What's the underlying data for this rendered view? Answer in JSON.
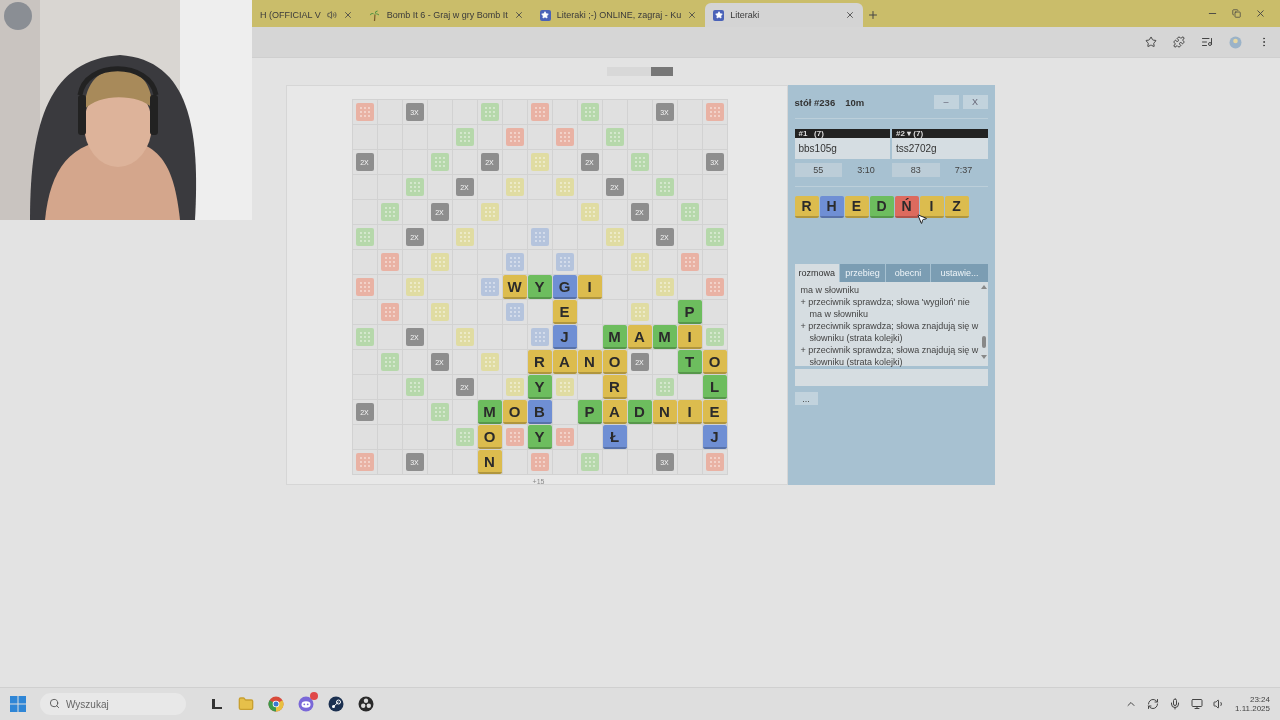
{
  "browser": {
    "tabs": [
      {
        "title": "H (OFFICIAL V",
        "kind": "music",
        "selected": false
      },
      {
        "title": "Bomb It 6 - Graj w gry Bomb It",
        "kind": "palm",
        "selected": false
      },
      {
        "title": "Literaki ;-) ONLINE, zagraj - Ku",
        "kind": "star",
        "selected": false
      },
      {
        "title": "Literaki",
        "kind": "star",
        "selected": true
      }
    ]
  },
  "board": {
    "rows": [
      [
        {
          "kind": "bonus",
          "color": "#e9b2a4"
        },
        {
          "kind": "plain"
        },
        {
          "kind": "multiplier",
          "label": "3X"
        },
        {
          "kind": "plain"
        },
        {
          "kind": "plain"
        },
        {
          "kind": "bonus",
          "color": "#b6d8ab"
        },
        {
          "kind": "plain"
        },
        {
          "kind": "bonus",
          "color": "#e9b2a4"
        },
        {
          "kind": "plain"
        },
        {
          "kind": "bonus",
          "color": "#b6d8ab"
        },
        {
          "kind": "plain"
        },
        {
          "kind": "plain"
        },
        {
          "kind": "multiplier",
          "label": "3X"
        },
        {
          "kind": "plain"
        },
        {
          "kind": "bonus",
          "color": "#e9b2a4"
        }
      ],
      [
        {
          "kind": "plain"
        },
        {
          "kind": "plain"
        },
        {
          "kind": "plain"
        },
        {
          "kind": "plain"
        },
        {
          "kind": "bonus",
          "color": "#b6d8ab"
        },
        {
          "kind": "plain"
        },
        {
          "kind": "bonus",
          "color": "#e9b2a4"
        },
        {
          "kind": "plain"
        },
        {
          "kind": "bonus",
          "color": "#e9b2a4"
        },
        {
          "kind": "plain"
        },
        {
          "kind": "bonus",
          "color": "#b6d8ab"
        },
        {
          "kind": "plain"
        },
        {
          "kind": "plain"
        },
        {
          "kind": "plain"
        },
        {
          "kind": "plain"
        }
      ],
      [
        {
          "kind": "multiplier",
          "label": "2X"
        },
        {
          "kind": "plain"
        },
        {
          "kind": "plain"
        },
        {
          "kind": "bonus",
          "color": "#b6d8ab"
        },
        {
          "kind": "plain"
        },
        {
          "kind": "multiplier",
          "label": "2X"
        },
        {
          "kind": "plain"
        },
        {
          "kind": "bonus",
          "color": "#e0dca2"
        },
        {
          "kind": "plain"
        },
        {
          "kind": "multiplier",
          "label": "2X"
        },
        {
          "kind": "plain"
        },
        {
          "kind": "bonus",
          "color": "#b6d8ab"
        },
        {
          "kind": "plain"
        },
        {
          "kind": "plain"
        },
        {
          "kind": "multiplier",
          "label": "3X"
        }
      ],
      [
        {
          "kind": "plain"
        },
        {
          "kind": "plain"
        },
        {
          "kind": "bonus",
          "color": "#b6d8ab"
        },
        {
          "kind": "plain"
        },
        {
          "kind": "multiplier",
          "label": "2X"
        },
        {
          "kind": "plain"
        },
        {
          "kind": "bonus",
          "color": "#e0dca2"
        },
        {
          "kind": "plain"
        },
        {
          "kind": "bonus",
          "color": "#e0dca2"
        },
        {
          "kind": "plain"
        },
        {
          "kind": "multiplier",
          "label": "2X"
        },
        {
          "kind": "plain"
        },
        {
          "kind": "bonus",
          "color": "#b6d8ab"
        },
        {
          "kind": "plain"
        },
        {
          "kind": "plain"
        }
      ],
      [
        {
          "kind": "plain"
        },
        {
          "kind": "bonus",
          "color": "#b6d8ab"
        },
        {
          "kind": "plain"
        },
        {
          "kind": "multiplier",
          "label": "2X"
        },
        {
          "kind": "plain"
        },
        {
          "kind": "bonus",
          "color": "#e0dca2"
        },
        {
          "kind": "plain"
        },
        {
          "kind": "plain"
        },
        {
          "kind": "plain"
        },
        {
          "kind": "bonus",
          "color": "#e0dca2"
        },
        {
          "kind": "plain"
        },
        {
          "kind": "multiplier",
          "label": "2X"
        },
        {
          "kind": "plain"
        },
        {
          "kind": "bonus",
          "color": "#b6d8ab"
        },
        {
          "kind": "plain"
        }
      ],
      [
        {
          "kind": "bonus",
          "color": "#b6d8ab"
        },
        {
          "kind": "plain"
        },
        {
          "kind": "multiplier",
          "label": "2X"
        },
        {
          "kind": "plain"
        },
        {
          "kind": "bonus",
          "color": "#e0dca2"
        },
        {
          "kind": "plain"
        },
        {
          "kind": "plain"
        },
        {
          "kind": "bonus",
          "color": "#b5c4dd"
        },
        {
          "kind": "plain"
        },
        {
          "kind": "plain"
        },
        {
          "kind": "bonus",
          "color": "#e0dca2"
        },
        {
          "kind": "plain"
        },
        {
          "kind": "multiplier",
          "label": "2X"
        },
        {
          "kind": "plain"
        },
        {
          "kind": "bonus",
          "color": "#b6d8ab"
        }
      ],
      [
        {
          "kind": "plain"
        },
        {
          "kind": "bonus",
          "color": "#e9b2a4"
        },
        {
          "kind": "plain"
        },
        {
          "kind": "bonus",
          "color": "#e0dca2"
        },
        {
          "kind": "plain"
        },
        {
          "kind": "plain"
        },
        {
          "kind": "bonus",
          "color": "#b5c4dd"
        },
        {
          "kind": "plain"
        },
        {
          "kind": "bonus",
          "color": "#b5c4dd"
        },
        {
          "kind": "plain"
        },
        {
          "kind": "plain"
        },
        {
          "kind": "bonus",
          "color": "#e0dca2"
        },
        {
          "kind": "plain"
        },
        {
          "kind": "bonus",
          "color": "#e9b2a4"
        },
        {
          "kind": "plain"
        }
      ],
      [
        {
          "kind": "bonus",
          "color": "#e9b2a4"
        },
        {
          "kind": "plain"
        },
        {
          "kind": "bonus",
          "color": "#e0dca2"
        },
        {
          "kind": "plain"
        },
        {
          "kind": "plain"
        },
        {
          "kind": "bonus",
          "color": "#b5c4dd"
        },
        {
          "kind": "tile",
          "letter": "W",
          "color": "#dcbc4e"
        },
        {
          "kind": "tile",
          "letter": "Y",
          "color": "#6dbd5e"
        },
        {
          "kind": "tile",
          "letter": "G",
          "color": "#6f8fd4"
        },
        {
          "kind": "tile",
          "letter": "I",
          "color": "#dcbc4e"
        },
        {
          "kind": "plain"
        },
        {
          "kind": "plain"
        },
        {
          "kind": "bonus",
          "color": "#e0dca2"
        },
        {
          "kind": "plain"
        },
        {
          "kind": "bonus",
          "color": "#e9b2a4"
        }
      ],
      [
        {
          "kind": "plain"
        },
        {
          "kind": "bonus",
          "color": "#e9b2a4"
        },
        {
          "kind": "plain"
        },
        {
          "kind": "bonus",
          "color": "#e0dca2"
        },
        {
          "kind": "plain"
        },
        {
          "kind": "plain"
        },
        {
          "kind": "bonus",
          "color": "#b5c4dd"
        },
        {
          "kind": "plain"
        },
        {
          "kind": "tile",
          "letter": "E",
          "color": "#dcbc4e"
        },
        {
          "kind": "plain"
        },
        {
          "kind": "plain"
        },
        {
          "kind": "bonus",
          "color": "#e0dca2"
        },
        {
          "kind": "plain"
        },
        {
          "kind": "tile",
          "letter": "P",
          "color": "#6dbd5e"
        },
        {
          "kind": "plain"
        }
      ],
      [
        {
          "kind": "bonus",
          "color": "#b6d8ab"
        },
        {
          "kind": "plain"
        },
        {
          "kind": "multiplier",
          "label": "2X"
        },
        {
          "kind": "plain"
        },
        {
          "kind": "bonus",
          "color": "#e0dca2"
        },
        {
          "kind": "plain"
        },
        {
          "kind": "plain"
        },
        {
          "kind": "bonus",
          "color": "#b5c4dd"
        },
        {
          "kind": "tile",
          "letter": "J",
          "color": "#6f8fd4"
        },
        {
          "kind": "plain"
        },
        {
          "kind": "tile",
          "letter": "M",
          "color": "#6dbd5e"
        },
        {
          "kind": "tile",
          "letter": "A",
          "color": "#dcbc4e"
        },
        {
          "kind": "tile",
          "letter": "M",
          "color": "#6dbd5e"
        },
        {
          "kind": "tile",
          "letter": "I",
          "color": "#dcbc4e"
        },
        {
          "kind": "bonus",
          "color": "#b6d8ab"
        }
      ],
      [
        {
          "kind": "plain"
        },
        {
          "kind": "bonus",
          "color": "#b6d8ab"
        },
        {
          "kind": "plain"
        },
        {
          "kind": "multiplier",
          "label": "2X"
        },
        {
          "kind": "plain"
        },
        {
          "kind": "bonus",
          "color": "#e0dca2"
        },
        {
          "kind": "plain"
        },
        {
          "kind": "tile",
          "letter": "R",
          "color": "#dcbc4e"
        },
        {
          "kind": "tile",
          "letter": "A",
          "color": "#dcbc4e"
        },
        {
          "kind": "tile",
          "letter": "N",
          "color": "#dcbc4e"
        },
        {
          "kind": "tile",
          "letter": "O",
          "color": "#dcbc4e"
        },
        {
          "kind": "multiplier",
          "label": "2X"
        },
        {
          "kind": "plain"
        },
        {
          "kind": "tile",
          "letter": "T",
          "color": "#6dbd5e"
        },
        {
          "kind": "tile",
          "letter": "O",
          "color": "#dcbc4e"
        }
      ],
      [
        {
          "kind": "plain"
        },
        {
          "kind": "plain"
        },
        {
          "kind": "bonus",
          "color": "#b6d8ab"
        },
        {
          "kind": "plain"
        },
        {
          "kind": "multiplier",
          "label": "2X"
        },
        {
          "kind": "plain"
        },
        {
          "kind": "bonus",
          "color": "#e0dca2"
        },
        {
          "kind": "tile",
          "letter": "Y",
          "color": "#6dbd5e"
        },
        {
          "kind": "bonus",
          "color": "#e0dca2"
        },
        {
          "kind": "plain"
        },
        {
          "kind": "tile",
          "letter": "R",
          "color": "#dcbc4e"
        },
        {
          "kind": "plain"
        },
        {
          "kind": "bonus",
          "color": "#b6d8ab"
        },
        {
          "kind": "plain"
        },
        {
          "kind": "tile",
          "letter": "L",
          "color": "#6dbd5e"
        }
      ],
      [
        {
          "kind": "multiplier",
          "label": "2X"
        },
        {
          "kind": "plain"
        },
        {
          "kind": "plain"
        },
        {
          "kind": "bonus",
          "color": "#b6d8ab"
        },
        {
          "kind": "plain"
        },
        {
          "kind": "tile",
          "letter": "M",
          "color": "#6dbd5e"
        },
        {
          "kind": "tile",
          "letter": "O",
          "color": "#dcbc4e"
        },
        {
          "kind": "tile",
          "letter": "B",
          "color": "#6f8fd4"
        },
        {
          "kind": "plain"
        },
        {
          "kind": "tile",
          "letter": "P",
          "color": "#6dbd5e"
        },
        {
          "kind": "tile",
          "letter": "A",
          "color": "#dcbc4e"
        },
        {
          "kind": "tile",
          "letter": "D",
          "color": "#6dbd5e"
        },
        {
          "kind": "tile",
          "letter": "N",
          "color": "#dcbc4e"
        },
        {
          "kind": "tile",
          "letter": "I",
          "color": "#dcbc4e"
        },
        {
          "kind": "tile",
          "letter": "E",
          "color": "#dcbc4e"
        }
      ],
      [
        {
          "kind": "plain"
        },
        {
          "kind": "plain"
        },
        {
          "kind": "plain"
        },
        {
          "kind": "plain"
        },
        {
          "kind": "bonus",
          "color": "#b6d8ab"
        },
        {
          "kind": "tile",
          "letter": "O",
          "color": "#dcbc4e"
        },
        {
          "kind": "bonus",
          "color": "#e9b2a4"
        },
        {
          "kind": "tile",
          "letter": "Y",
          "color": "#6dbd5e"
        },
        {
          "kind": "bonus",
          "color": "#e9b2a4"
        },
        {
          "kind": "plain"
        },
        {
          "kind": "tile",
          "letter": "Ł",
          "color": "#6f8fd4"
        },
        {
          "kind": "plain"
        },
        {
          "kind": "plain"
        },
        {
          "kind": "plain"
        },
        {
          "kind": "tile",
          "letter": "J",
          "color": "#6f8fd4"
        }
      ],
      [
        {
          "kind": "bonus",
          "color": "#e9b2a4"
        },
        {
          "kind": "plain"
        },
        {
          "kind": "multiplier",
          "label": "3X"
        },
        {
          "kind": "plain"
        },
        {
          "kind": "plain"
        },
        {
          "kind": "tile",
          "letter": "N",
          "color": "#dcbc4e"
        },
        {
          "kind": "plain"
        },
        {
          "kind": "bonus",
          "color": "#e9b2a4"
        },
        {
          "kind": "plain"
        },
        {
          "kind": "bonus",
          "color": "#b6d8ab"
        },
        {
          "kind": "plain"
        },
        {
          "kind": "plain"
        },
        {
          "kind": "multiplier",
          "label": "3X"
        },
        {
          "kind": "plain"
        },
        {
          "kind": "bonus",
          "color": "#e9b2a4"
        }
      ]
    ],
    "footer": "+15"
  },
  "side_panel": {
    "table": "stół #236",
    "time_control": "10m",
    "buttons": [
      "–",
      "X"
    ],
    "players": [
      {
        "header": "#1   (7)",
        "name": "bbs105g",
        "score": "55",
        "clock": "3:10"
      },
      {
        "header": "#2 ▾ (7)",
        "name": "tss2702g",
        "score": "83",
        "clock": "7:37"
      }
    ],
    "rack": [
      {
        "letter": "R",
        "color": "#dcbc4e"
      },
      {
        "letter": "H",
        "color": "#6f8fd4"
      },
      {
        "letter": "E",
        "color": "#dcbc4e"
      },
      {
        "letter": "D",
        "color": "#6dbd5e"
      },
      {
        "letter": "Ń",
        "color": "#dd6a5e"
      },
      {
        "letter": "I",
        "color": "#dcbc4e"
      },
      {
        "letter": "Z",
        "color": "#dcbc4e"
      }
    ],
    "tabs": [
      {
        "label": "rozmowa",
        "selected": true
      },
      {
        "label": "przebieg",
        "selected": false
      },
      {
        "label": "obecni",
        "selected": false
      },
      {
        "label": "ustawie...",
        "selected": false
      }
    ],
    "messages": [
      "ma w słowniku",
      "+ przeciwnik sprawdza; słowa 'wygiloń' nie ma w słowniku",
      "+ przeciwnik sprawdza; słowa znajdują się w słowniku (strata kolejki)",
      "+ przeciwnik sprawdza; słowa znajdują się w słowniku (strata kolejki)"
    ],
    "more_button": "..."
  },
  "taskbar": {
    "search": {
      "placeholder": "Wyszukaj"
    },
    "time": "23:24",
    "date": "1.11.2025"
  }
}
